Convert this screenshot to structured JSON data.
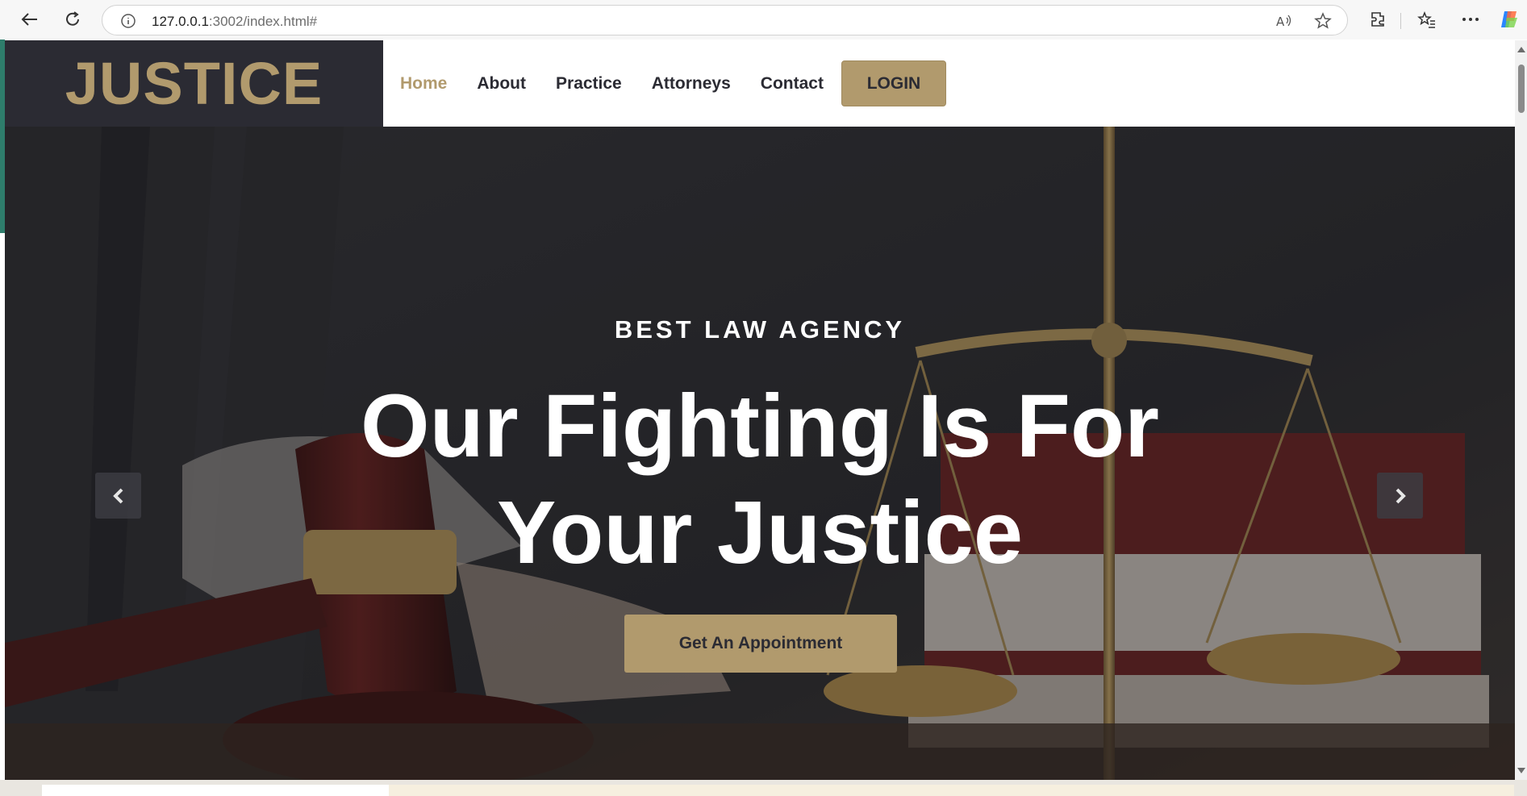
{
  "browser": {
    "url_host": "127.0.0.1",
    "url_path": ":3002/index.html#"
  },
  "site": {
    "brand": "JUSTICE",
    "nav": [
      {
        "label": "Home",
        "active": true
      },
      {
        "label": "About"
      },
      {
        "label": "Practice"
      },
      {
        "label": "Attorneys"
      },
      {
        "label": "Contact"
      }
    ],
    "login_label": "LOGIN"
  },
  "hero": {
    "kicker": "BEST LAW AGENCY",
    "headline_line1": "Our Fighting Is For",
    "headline_line2": "Your Justice",
    "cta_label": "Get An Appointment"
  },
  "colors": {
    "accent": "#b19a6d",
    "dark": "#2b2b33"
  },
  "icons": {
    "back": "back-arrow-icon",
    "reload": "reload-icon",
    "info": "info-icon",
    "read_aloud": "read-aloud-icon",
    "favorite": "star-icon",
    "extensions": "extensions-icon",
    "favorites_list": "favorites-icon",
    "more": "more-icon",
    "copilot": "copilot-icon",
    "prev": "chevron-left-icon",
    "next": "chevron-right-icon"
  }
}
